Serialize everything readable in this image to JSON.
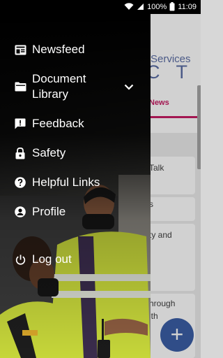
{
  "status_bar": {
    "battery": "100%",
    "time": "11:09"
  },
  "background_app": {
    "logo_word": "Services",
    "logo_letters": "C T",
    "active_tab": "News",
    "cards": [
      "Talk",
      "s",
      "ty and",
      "hrough",
      "lth"
    ]
  },
  "drawer": {
    "items": [
      {
        "label": "Newsfeed",
        "icon": "newspaper-icon"
      },
      {
        "label": "Document Library",
        "line1": "Document",
        "line2": "Library",
        "icon": "folder-icon",
        "expandable": true
      },
      {
        "label": "Feedback",
        "icon": "feedback-icon"
      },
      {
        "label": "Safety",
        "icon": "lock-icon"
      },
      {
        "label": "Helpful Links",
        "icon": "help-circle-icon"
      },
      {
        "label": "Profile",
        "icon": "account-circle-icon"
      },
      {
        "label": "Log out",
        "icon": "power-icon"
      }
    ]
  },
  "fab": {
    "symbol": "+"
  },
  "colors": {
    "accent": "#c71b63",
    "brand": "#3b5ea6",
    "hi_vis": "#c6d63a"
  }
}
